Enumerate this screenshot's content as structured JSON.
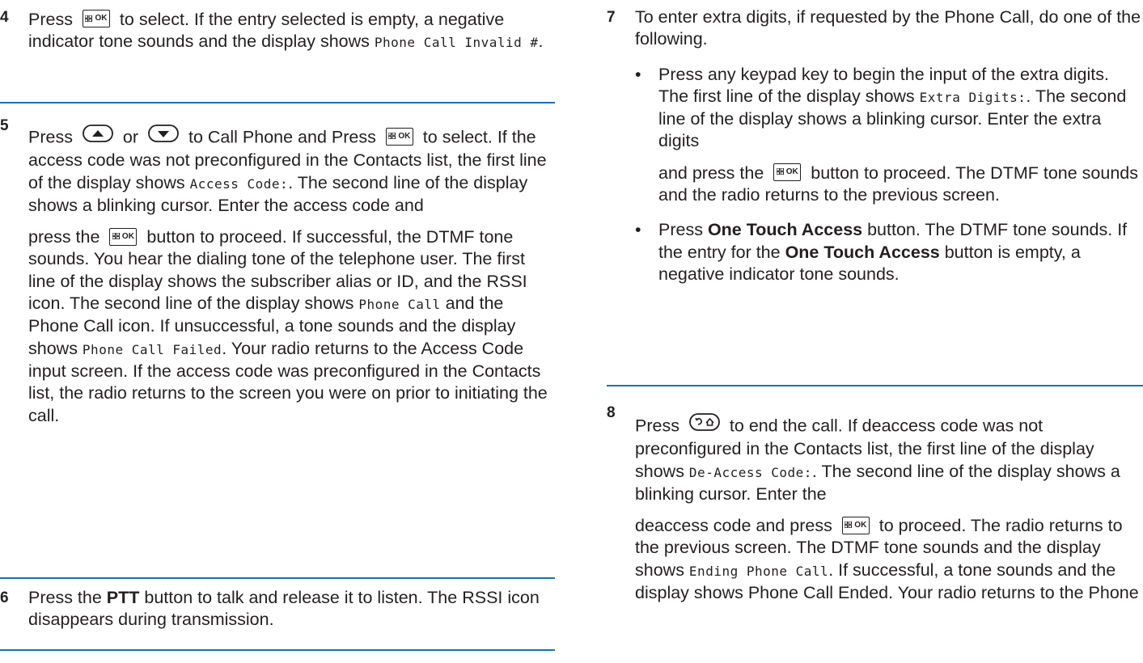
{
  "left": {
    "step4": {
      "num": "4",
      "t1": "Press ",
      "t2": " to select. If the entry selected is empty, a negative indicator tone sounds and the display shows ",
      "code1": "Phone Call Invalid #",
      "t3": "."
    },
    "step5": {
      "num": "5",
      "t1": "Press ",
      "t2": " or ",
      "t3": " to Call Phone and Press ",
      "t4": " to select. If the access code was not preconfigured in the Contacts list, the first line of the display shows ",
      "code1": "Access Code:",
      "t5": ". The second line of the display shows a blinking cursor. Enter the access code and",
      "t6": "press the ",
      "t7": " button to proceed. If successful, the DTMF tone sounds. You hear the dialing tone of the telephone user. The first line of the display shows the subscriber alias or ID, and the RSSI icon. The second line of the display shows ",
      "code2": "Phone Call",
      "t8": " and the Phone Call icon. If unsuccessful, a tone sounds and the display shows ",
      "code3": "Phone Call Failed",
      "t9": ". Your radio returns to the Access Code input screen. If the access code was preconfigured in the Contacts list, the radio returns to the screen you were on prior to initiating the call."
    },
    "step6": {
      "num": "6",
      "t1": "Press the ",
      "bold1": "PTT",
      "t2": " button to talk and release it to listen. The RSSI icon disappears during transmission."
    }
  },
  "right": {
    "step7": {
      "num": "7",
      "intro": "To enter extra digits, if requested by the Phone Call, do one of the following.",
      "bullet_char": "•",
      "b1_t1": "Press any keypad key to begin the input of the extra digits. The first line of the display shows ",
      "b1_code": "Extra Digits:",
      "b1_t2": ". The second line of the display shows a blinking cursor. Enter the extra digits",
      "b1_t3": "and press the ",
      "b1_t4": " button to proceed. The DTMF tone sounds and the radio returns to the previous screen.",
      "b2_t1": "Press ",
      "b2_bold1": "One Touch Access",
      "b2_t2": " button. The DTMF tone sounds. If the entry for the ",
      "b2_bold2": "One Touch Access",
      "b2_t3": " button is empty, a negative indicator tone sounds."
    },
    "step8": {
      "num": "8",
      "t1": "Press ",
      "t2": " to end the call. If deaccess code was not preconfigured in the Contacts list, the first line of the display shows ",
      "code1": "De-Access Code:",
      "t3": ". The second line of the display shows a blinking cursor. Enter the",
      "t4": "deaccess code and press ",
      "t5": " to proceed. The radio returns to the previous screen. The DTMF tone sounds and the display shows ",
      "code2": "Ending Phone Call",
      "t6": ". If successful, a tone sounds and the display shows Phone Call Ended. Your radio returns to the Phone"
    }
  },
  "icons": {
    "ok_label": "OK"
  },
  "colors": {
    "rule": "#1e6fb5",
    "text": "#231f20"
  }
}
